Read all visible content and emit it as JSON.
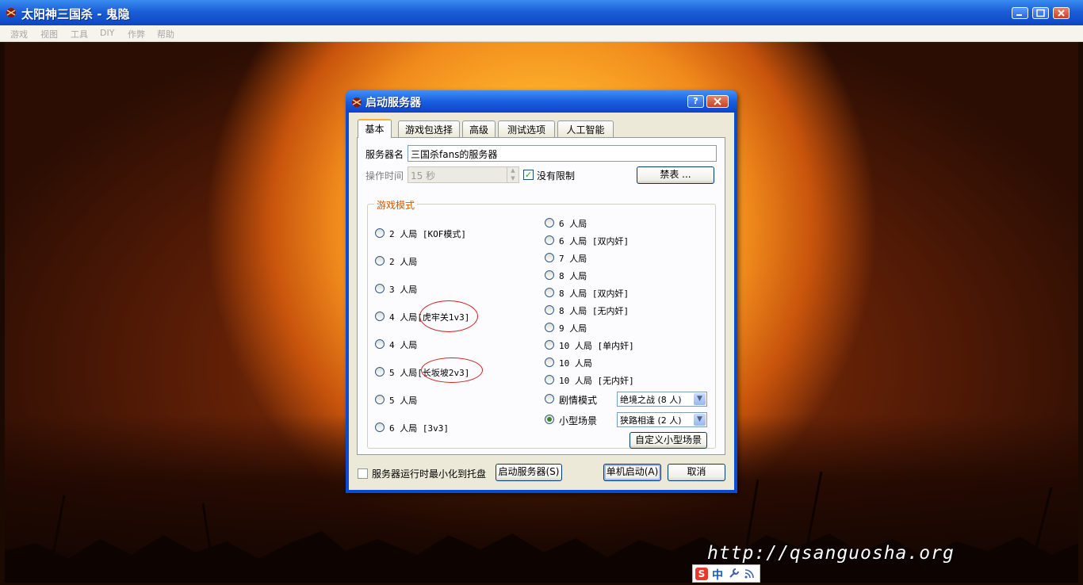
{
  "window": {
    "title": "太阳神三国杀 - 鬼隐",
    "menu": [
      "游戏",
      "视图",
      "工具",
      "DIY",
      "作弊",
      "帮助"
    ]
  },
  "background": {
    "watermark": "http://qsanguosha.org",
    "ime_label": "中"
  },
  "dialog": {
    "title": "启动服务器",
    "help_label": "?",
    "tabs": [
      "基本",
      "游戏包选择",
      "高级",
      "测试选项",
      "人工智能"
    ],
    "server_name_label": "服务器名",
    "server_name_value": "三国杀fans的服务器",
    "operation_time_label": "操作时间",
    "operation_time_value": "15 秒",
    "no_limit_label": "没有限制",
    "no_limit_checked": true,
    "ban_list_button": "禁表 ...",
    "game_mode_group": "游戏模式",
    "left_modes": [
      {
        "prefix": "2 人局",
        "suffix": "[KOF模式]"
      },
      {
        "prefix": "2 人局",
        "suffix": ""
      },
      {
        "prefix": "3 人局",
        "suffix": ""
      },
      {
        "prefix": "4 人局",
        "suffix": "[虎牢关1v3]"
      },
      {
        "prefix": "4 人局",
        "suffix": ""
      },
      {
        "prefix": "5 人局",
        "suffix": "[长坂坡2v3]"
      },
      {
        "prefix": "5 人局",
        "suffix": ""
      },
      {
        "prefix": "6 人局",
        "suffix": "[3v3]"
      }
    ],
    "right_modes": [
      "6 人局",
      "6 人局 [双内奸]",
      "7 人局",
      "8 人局",
      "8 人局 [双内奸]",
      "8 人局 [无内奸]",
      "9 人局",
      "10 人局 [单内奸]",
      "10 人局",
      "10 人局 [无内奸]"
    ],
    "scenario_mode_label": "剧情模式",
    "scenario_mode_value": "绝境之战 (8 人)",
    "mini_scene_label": "小型场景",
    "mini_scene_value": "狭路相逢 (2 人)",
    "selected_mode": "小型场景",
    "custom_mini_scene_button": "自定义小型场景",
    "minimize_to_tray_label": "服务器运行时最小化到托盘",
    "minimize_to_tray_checked": false,
    "start_server_button": "启动服务器(S)",
    "standalone_button": "单机启动(A)",
    "cancel_button": "取消"
  }
}
